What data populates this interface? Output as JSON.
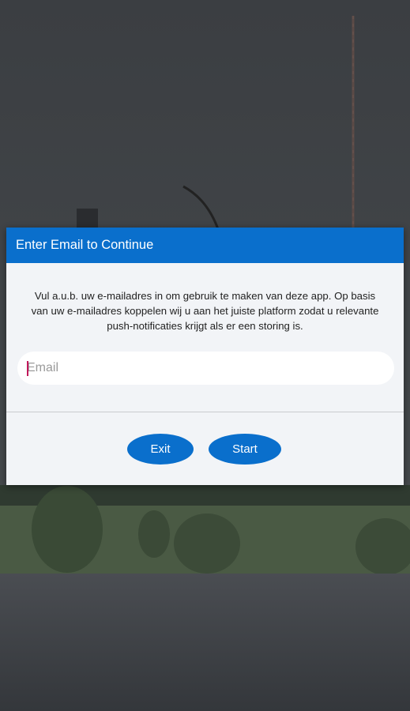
{
  "dialog": {
    "title": "Enter Email to Continue",
    "message": "Vul a.u.b. uw e-mailadres in om gebruik te maken van deze app. Op basis van uw e-mailadres koppelen wij u aan het juiste platform zodat u relevante push-notificaties krijgt als er een storing is.",
    "email": {
      "placeholder": "Email",
      "value": ""
    },
    "buttons": {
      "exit_label": "Exit",
      "start_label": "Start"
    }
  },
  "colors": {
    "accent": "#0a6fcc",
    "dialog_bg": "#f2f4f7",
    "caret": "#c2185b"
  }
}
